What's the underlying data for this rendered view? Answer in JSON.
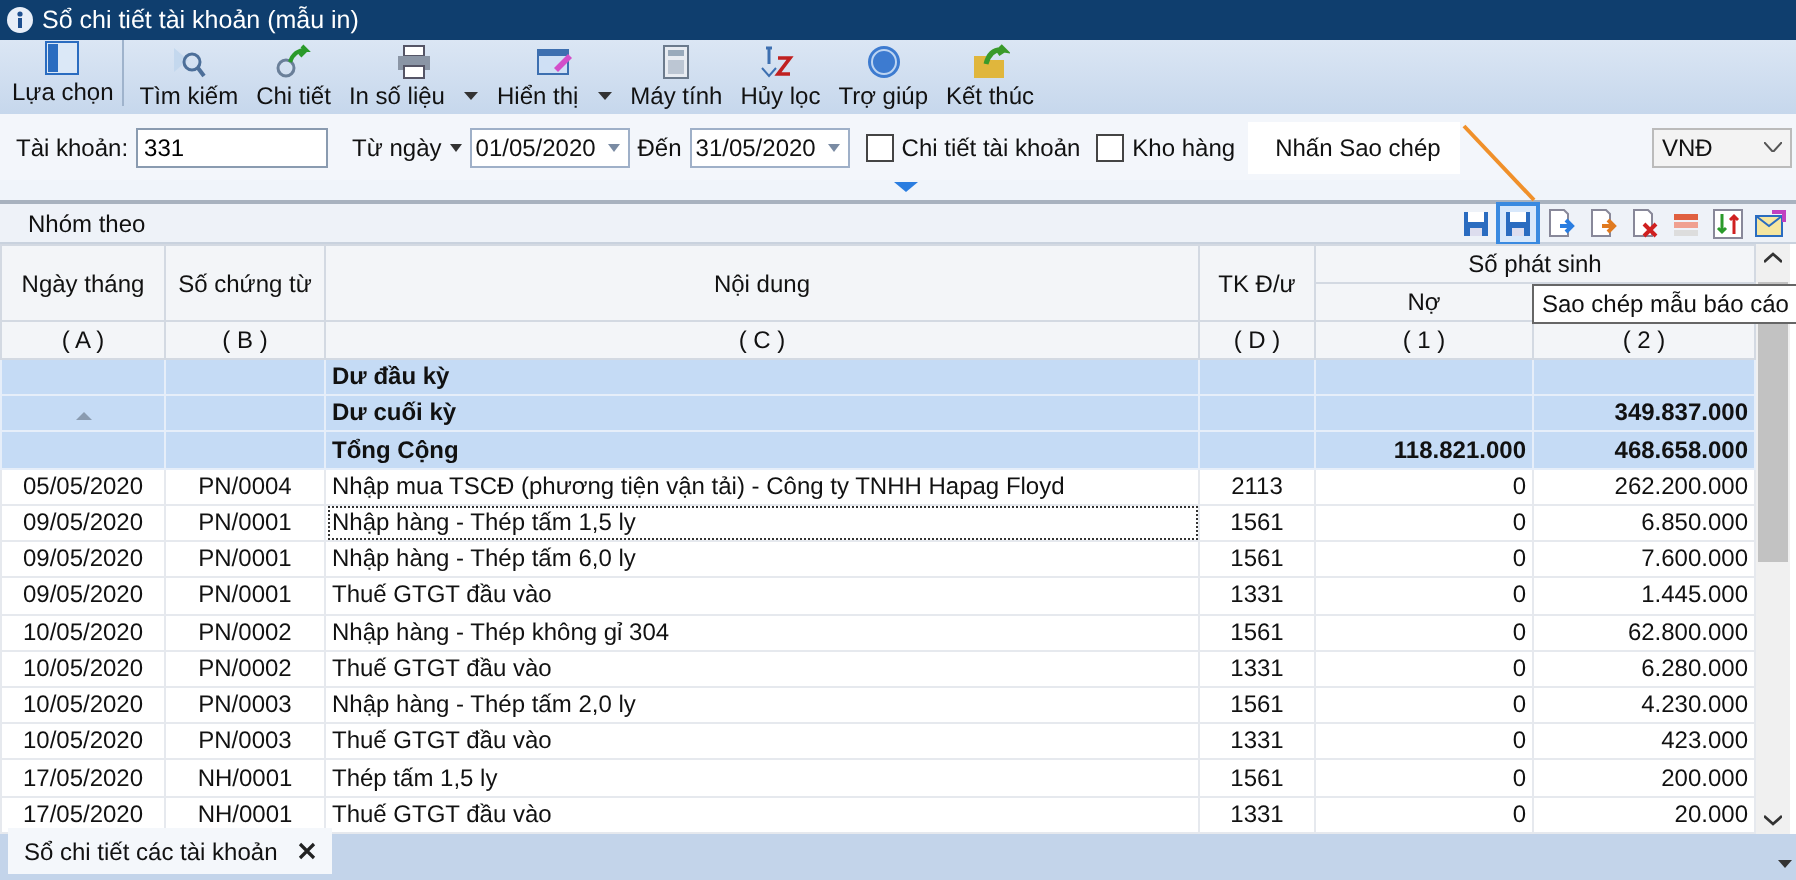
{
  "window": {
    "title": "Sổ chi tiết tài khoản (mẫu in)"
  },
  "toolbar": [
    {
      "label": "Lựa chọn",
      "has_menu": false,
      "separator_after": true
    },
    {
      "label": "Tìm kiếm",
      "has_menu": false,
      "separator_after": false
    },
    {
      "label": "Chi tiết",
      "has_menu": false,
      "separator_after": false
    },
    {
      "label": "In số liệu",
      "has_menu": true,
      "separator_after": false
    },
    {
      "label": "Hiển thị",
      "has_menu": true,
      "separator_after": false
    },
    {
      "label": "Máy tính",
      "has_menu": false,
      "separator_after": false
    },
    {
      "label": "Hủy lọc",
      "has_menu": false,
      "separator_after": false
    },
    {
      "label": "Trợ giúp",
      "has_menu": false,
      "separator_after": false
    },
    {
      "label": "Kết thúc",
      "has_menu": false,
      "separator_after": false
    }
  ],
  "filter": {
    "account_label": "Tài khoản:",
    "account": "331",
    "from_label": "Từ ngày",
    "from": "01/05/2020",
    "to_label": "Đến",
    "to": "31/05/2020",
    "checkboxes": [
      {
        "label": "Chi tiết tài khoản",
        "checked": false
      },
      {
        "label": "Kho hàng",
        "checked": false
      }
    ],
    "currency": "VNĐ"
  },
  "callout": {
    "text": "Nhấn Sao chép"
  },
  "group_bar": {
    "label": "Nhóm theo",
    "tools": [
      {
        "highlighted": false
      },
      {
        "highlighted": true
      },
      {
        "highlighted": false
      },
      {
        "highlighted": false
      },
      {
        "highlighted": false
      },
      {
        "highlighted": false
      },
      {
        "highlighted": false
      },
      {
        "highlighted": false
      }
    ]
  },
  "tooltip": "Sao chép mẫu báo cáo",
  "table": {
    "columns": [
      "Ngày tháng",
      "Số chứng từ",
      "Nội dung",
      "TK Đ/ư"
    ],
    "group_header": "Số phát sinh",
    "sub_columns": [
      "Nợ"
    ],
    "index_row": [
      "( A )",
      "( B )",
      "( C )",
      "( D )",
      "( 1 )",
      "( 2 )"
    ],
    "summary_rows": [
      {
        "label": "Dư đầu kỳ",
        "debit": "",
        "credit": ""
      },
      {
        "label": "Dư cuối kỳ",
        "debit": "",
        "credit": "349.837.000"
      },
      {
        "label": "Tổng Cộng",
        "debit": "118.821.000",
        "credit": "468.658.000"
      }
    ],
    "rows": [
      {
        "date": "05/05/2020",
        "voucher": "PN/0004",
        "content": "Nhập mua TSCĐ (phương tiện vận tải) - Công ty TNHH Hapag Floyd",
        "account": "2113",
        "debit": "0",
        "credit": "262.200.000",
        "focused": false
      },
      {
        "date": "09/05/2020",
        "voucher": "PN/0001",
        "content": "Nhập hàng - Thép tấm 1,5 ly",
        "account": "1561",
        "debit": "0",
        "credit": "6.850.000",
        "focused": true
      },
      {
        "date": "09/05/2020",
        "voucher": "PN/0001",
        "content": "Nhập hàng - Thép tấm 6,0 ly",
        "account": "1561",
        "debit": "0",
        "credit": "7.600.000",
        "focused": false
      },
      {
        "date": "09/05/2020",
        "voucher": "PN/0001",
        "content": "Thuế GTGT đầu vào",
        "account": "1331",
        "debit": "0",
        "credit": "1.445.000",
        "focused": false
      },
      {
        "date": "10/05/2020",
        "voucher": "PN/0002",
        "content": "Nhập hàng - Thép không gỉ 304",
        "account": "1561",
        "debit": "0",
        "credit": "62.800.000",
        "focused": false
      },
      {
        "date": "10/05/2020",
        "voucher": "PN/0002",
        "content": "Thuế GTGT đầu vào",
        "account": "1331",
        "debit": "0",
        "credit": "6.280.000",
        "focused": false
      },
      {
        "date": "10/05/2020",
        "voucher": "PN/0003",
        "content": "Nhập hàng - Thép tấm 2,0 ly",
        "account": "1561",
        "debit": "0",
        "credit": "4.230.000",
        "focused": false
      },
      {
        "date": "10/05/2020",
        "voucher": "PN/0003",
        "content": "Thuế GTGT đầu vào",
        "account": "1331",
        "debit": "0",
        "credit": "423.000",
        "focused": false
      },
      {
        "date": "17/05/2020",
        "voucher": "NH/0001",
        "content": "Thép tấm 1,5 ly",
        "account": "1561",
        "debit": "0",
        "credit": "200.000",
        "focused": false
      },
      {
        "date": "17/05/2020",
        "voucher": "NH/0001",
        "content": "Thuế GTGT đầu vào",
        "account": "1331",
        "debit": "0",
        "credit": "20.000",
        "focused": false
      }
    ]
  },
  "tabs": [
    {
      "label": "Sổ chi tiết các tài khoản",
      "selected": true,
      "closable": true
    }
  ]
}
